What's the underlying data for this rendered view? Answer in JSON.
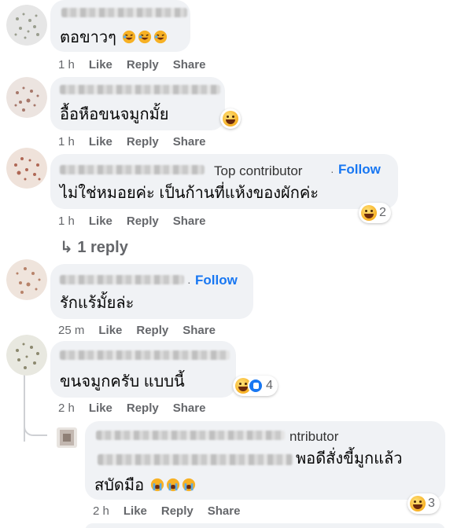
{
  "actions": {
    "like": "Like",
    "reply": "Reply",
    "share": "Share"
  },
  "comments": [
    {
      "text": "ตอขาวๆ",
      "time": "1 h"
    },
    {
      "text": "อื้อหือขนจมูกมั้ย",
      "time": "1 h"
    },
    {
      "badge": "Top contributor",
      "follow": "Follow",
      "text": "ไม่ใช่หมอยค่ะ เป็นก้านที่แห้งของผักค่ะ",
      "time": "1 h",
      "reactions": "2",
      "view_replies": "1 reply"
    },
    {
      "follow": "Follow",
      "text": "รักแร้มั้ยล่ะ",
      "time": "25 m"
    },
    {
      "text": "ขนจมูกครับ แบบนี้",
      "time": "2 h",
      "reactions": "4"
    }
  ],
  "reply": {
    "badge_partial": "ntributor",
    "line1": "พอดีสั่งขี้มูกแล้ว",
    "line2": "สบัดมือ",
    "time": "2 h",
    "reactions": "3"
  },
  "emoji": {
    "laughing": "laughing-tears",
    "grin": "grinning-face",
    "crying": "loudly-crying",
    "like": "thumbs-up"
  }
}
